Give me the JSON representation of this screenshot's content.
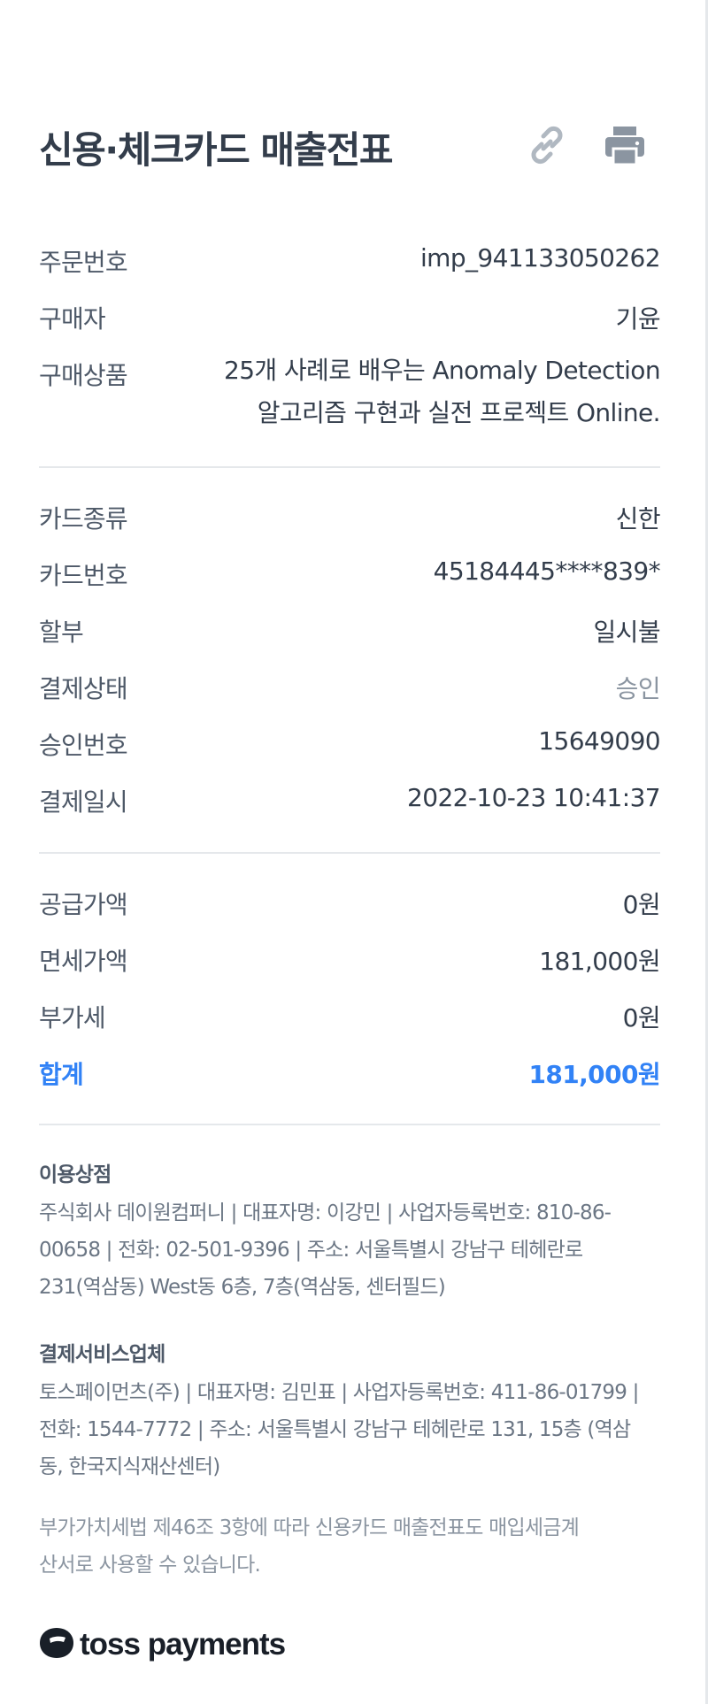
{
  "header": {
    "title": "신용·체크카드 매출전표",
    "link_icon": "link-icon",
    "print_icon": "printer-icon"
  },
  "order": {
    "rows": [
      {
        "label": "주문번호",
        "value": "imp_941133050262"
      },
      {
        "label": "구매자",
        "value": "기윤"
      },
      {
        "label": "구매상품",
        "value": "25개 사례로 배우는 Anomaly Detection 알고리즘 구현과 실전 프로젝트 Online."
      }
    ]
  },
  "payment": {
    "rows": [
      {
        "label": "카드종류",
        "value": "신한"
      },
      {
        "label": "카드번호",
        "value": "45184445****839*"
      },
      {
        "label": "할부",
        "value": "일시불"
      },
      {
        "label": "결제상태",
        "value": "승인"
      },
      {
        "label": "승인번호",
        "value": "15649090"
      },
      {
        "label": "결제일시",
        "value": "2022-10-23 10:41:37"
      }
    ]
  },
  "amounts": {
    "rows": [
      {
        "label": "공급가액",
        "value": "0원"
      },
      {
        "label": "면세가액",
        "value": "181,000원"
      },
      {
        "label": "부가세",
        "value": "0원"
      }
    ],
    "total": {
      "label": "합계",
      "value": "181,000원"
    }
  },
  "merchant": {
    "heading": "이용상점",
    "text": "주식회사 데이원컴퍼니 | 대표자명: 이강민 | 사업자등록번호: 810-86-00658 | 전화: 02-501-9396 | 주소: 서울특별시 강남구 테헤란로 231(역삼동) West동 6층, 7층(역삼동, 센터필드)"
  },
  "pg": {
    "heading": "결제서비스업체",
    "text": "토스페이먼츠(주) | 대표자명: 김민표 | 사업자등록번호: 411-86-01799 | 전화: 1544-7772 | 주소: 서울특별시 강남구 테헤란로 131, 15층 (역삼동, 한국지식재산센터)"
  },
  "notice": "부가가치세법 제46조 3항에 따라 신용카드 매출전표도 매입세금계산서로 사용할 수 있습니다.",
  "brand": {
    "name": "toss payments",
    "icon": "toss-logo-icon"
  },
  "colors": {
    "accent": "#3182f6",
    "text": "#333d4b",
    "muted": "#8b95a1"
  }
}
